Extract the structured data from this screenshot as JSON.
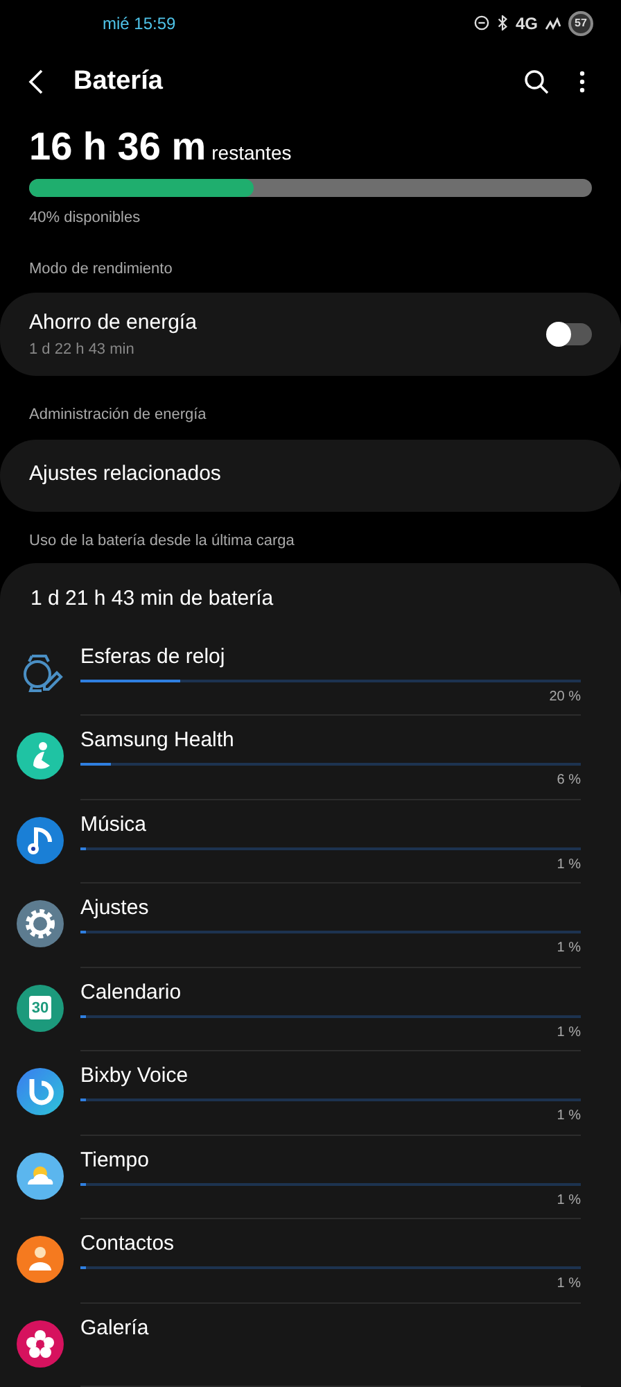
{
  "status_bar": {
    "time": "mié 15:59",
    "network": "4G",
    "battery": "57"
  },
  "header": {
    "title": "Batería"
  },
  "summary": {
    "remaining": "16 h 36 m",
    "remaining_label": "restantes",
    "level": 0.4,
    "available": "40% disponibles"
  },
  "sections": [
    {
      "title": "Modo de rendimiento",
      "kind": "toggle",
      "label": "Ahorro de energía",
      "subtitle": "1 d 22 h 43 min",
      "on": false
    },
    {
      "title": "Administración de energía",
      "kind": "link",
      "label": "Ajustes relacionados"
    }
  ],
  "usage": {
    "title": "Uso de la batería desde la última carga",
    "total": "1 d 21 h 43 min de batería",
    "apps": [
      {
        "name": "Esferas de reloj",
        "kind": "watch",
        "level": 0.2,
        "percent": "20 %"
      },
      {
        "name": "Samsung Health",
        "kind": "health",
        "level": 0.06,
        "percent": "6 %"
      },
      {
        "name": "Música",
        "kind": "music",
        "level": 0.01,
        "percent": "1 %"
      },
      {
        "name": "Ajustes",
        "kind": "settings",
        "level": 0.01,
        "percent": "1 %"
      },
      {
        "name": "Calendario",
        "kind": "calendar",
        "icon_text": "30",
        "level": 0.01,
        "percent": "1 %"
      },
      {
        "name": "Bixby Voice",
        "kind": "bixby",
        "level": 0.01,
        "percent": "1 %"
      },
      {
        "name": "Tiempo",
        "kind": "weather",
        "level": 0.01,
        "percent": "1 %"
      },
      {
        "name": "Contactos",
        "kind": "contacts",
        "level": 0.01,
        "percent": "1 %"
      },
      {
        "name": "Galería",
        "kind": "gallery"
      }
    ]
  }
}
